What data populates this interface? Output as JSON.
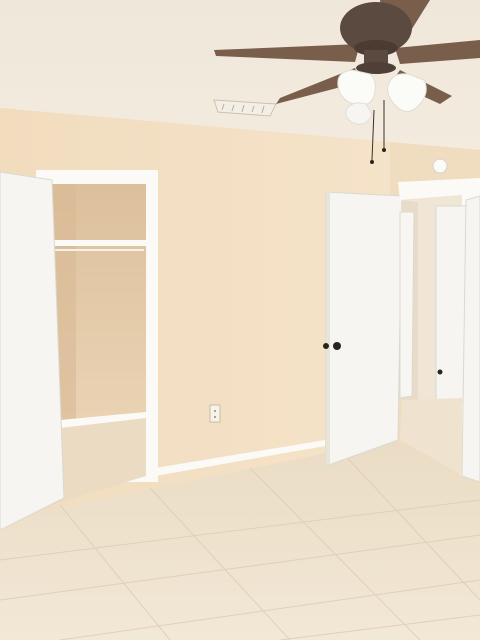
{
  "scene": {
    "watermark_text": "",
    "colors": {
      "ceiling": "#f1e8d8",
      "wall": "#f3dfc3",
      "wall_shade": "#e9d2b2",
      "floor": "#efe3cf",
      "grout": "#dccbb2",
      "door": "#f7f5f1",
      "door_edge": "#dcd8d0",
      "trim": "#fbfaf7",
      "closet_inner": "#e2c6a3",
      "fan_body": "#5a4a40",
      "fan_blade": "#7a5e4c",
      "globe": "#fbfbf8"
    }
  }
}
